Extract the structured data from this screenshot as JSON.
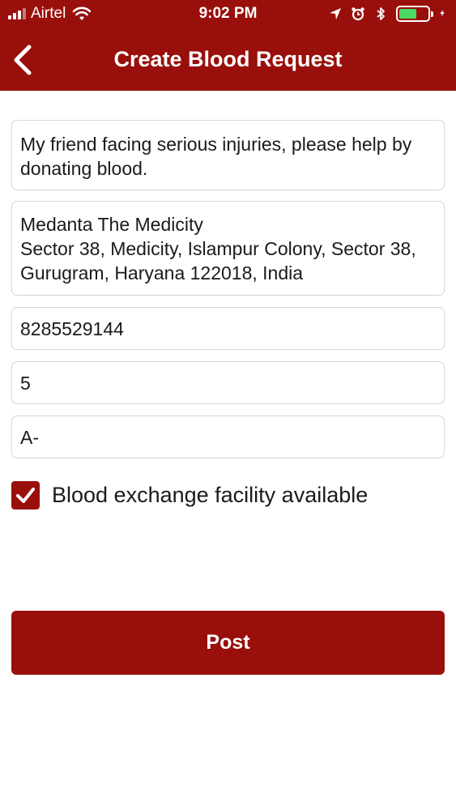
{
  "status_bar": {
    "carrier": "Airtel",
    "time": "9:02 PM",
    "icons": [
      "signal-icon",
      "wifi-icon",
      "location-arrow-icon",
      "alarm-icon",
      "bluetooth-icon",
      "battery-icon",
      "charging-bolt-icon"
    ],
    "battery_level": 0.62
  },
  "header": {
    "title": "Create Blood Request",
    "back_icon": "chevron-left-icon"
  },
  "form": {
    "description": "My friend facing serious injuries, please help by donating blood.",
    "address": "Medanta The Medicity\nSector 38, Medicity, Islampur Colony, Sector 38, Gurugram, Haryana 122018, India",
    "phone": "8285529144",
    "units": "5",
    "blood_group": "A-",
    "exchange_checkbox": {
      "label": "Blood exchange facility available",
      "checked": true
    },
    "post_label": "Post"
  },
  "colors": {
    "accent": "#990f0b",
    "battery_fill": "#4cd964",
    "field_border": "#d6d6d6"
  }
}
